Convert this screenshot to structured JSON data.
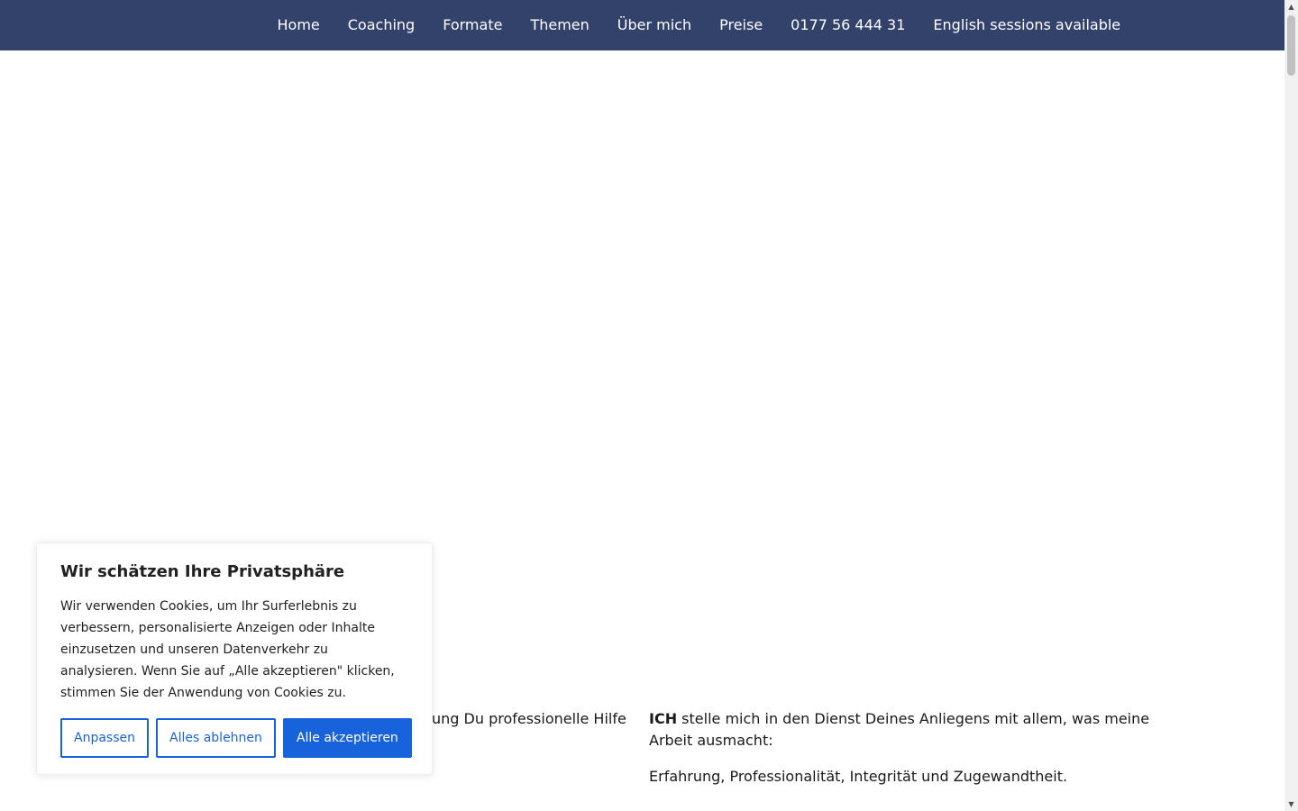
{
  "nav": {
    "items": [
      {
        "label": "Home"
      },
      {
        "label": "Coaching"
      },
      {
        "label": "Formate"
      },
      {
        "label": "Themen"
      },
      {
        "label": "Über mich"
      },
      {
        "label": "Preise"
      },
      {
        "label": "0177 56 444 31"
      },
      {
        "label": "English sessions available"
      }
    ]
  },
  "content": {
    "left_partial": "ung Du professionelle Hilfe",
    "right_p1_bold": "ICH",
    "right_p1_rest": " stelle mich in den Dienst Deines Anliegens mit allem, was meine Arbeit ausmacht:",
    "right_p2": "Erfahrung, Professionalität, Integrität und Zugewandtheit."
  },
  "cookie": {
    "title": "Wir schätzen Ihre Privatsphäre",
    "text": "Wir verwenden Cookies, um Ihr Surferlebnis zu verbessern, personalisierte Anzeigen oder Inhalte einzusetzen und unseren Datenverkehr zu analysieren. Wenn Sie auf „Alle akzeptieren\" klicken, stimmen Sie der Anwendung von Cookies zu.",
    "customize_label": "Anpassen",
    "reject_label": "Alles ablehnen",
    "accept_label": "Alle akzeptieren"
  },
  "scrollbar": {
    "up_icon": "chevron-up-icon",
    "down_icon": "chevron-down-icon"
  },
  "colors": {
    "nav_bg": "#32426b",
    "accent": "#1863dc"
  }
}
